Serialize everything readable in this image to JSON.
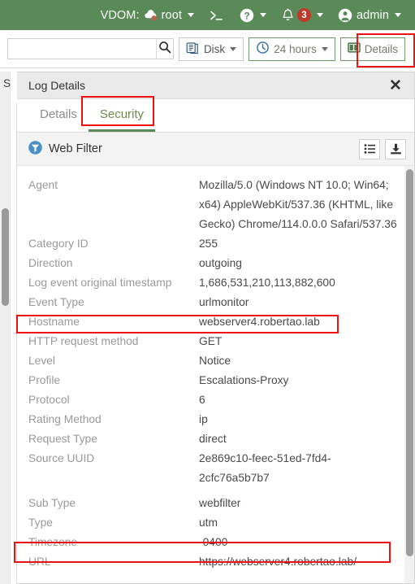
{
  "topbar": {
    "vdom_label": "VDOM:",
    "vdom_icon": "cloud-gear-icon",
    "vdom_value": "root",
    "cli_icon": "cli-console-icon",
    "help_icon": "help-question-icon",
    "alert_icon": "bell-icon",
    "alert_count": "3",
    "user_icon": "user-avatar-icon",
    "user_name": "admin"
  },
  "toolbar": {
    "search_value": "",
    "search_placeholder": "",
    "search_icon": "search-icon",
    "disk_label": "Disk",
    "disk_icon": "disk-stack-icon",
    "time_label": "24 hours",
    "time_icon": "clock-icon",
    "details_label": "Details",
    "details_icon": "panel-split-icon"
  },
  "background": {
    "left_fragment": "S"
  },
  "dialog": {
    "title": "Log Details",
    "close_icon": "close-icon",
    "tabs": [
      {
        "label": "Details",
        "active": false
      },
      {
        "label": "Security",
        "active": true
      }
    ],
    "section": {
      "icon": "web-filter-funnel-icon",
      "title": "Web Filter",
      "list_view_icon": "list-view-icon",
      "download_icon": "download-icon"
    },
    "rows": [
      {
        "key": "Agent",
        "value": "Mozilla/5.0 (Windows NT 10.0; Win64; x64) AppleWebKit/537.36 (KHTML, like Gecko) Chrome/114.0.0.0 Safari/537.36"
      },
      {
        "key": "Category ID",
        "value": "255"
      },
      {
        "key": "Direction",
        "value": "outgoing"
      },
      {
        "key": "Log event original timestamp",
        "value": "1,686,531,210,113,882,600"
      },
      {
        "key": "Event Type",
        "value": "urlmonitor"
      },
      {
        "key": "Hostname",
        "value": "webserver4.robertao.lab"
      },
      {
        "key": "HTTP request method",
        "value": "GET"
      },
      {
        "key": "Level",
        "value": "Notice"
      },
      {
        "key": "Profile",
        "value": "Escalations-Proxy"
      },
      {
        "key": "Protocol",
        "value": "6"
      },
      {
        "key": "Rating Method",
        "value": "ip"
      },
      {
        "key": "Request Type",
        "value": "direct"
      },
      {
        "key": "Source UUID",
        "value": "2e869c10-feec-51ed-7fd4-2cfc76a5b7b7"
      },
      {
        "key": "Sub Type",
        "value": "webfilter"
      },
      {
        "key": "Type",
        "value": "utm"
      },
      {
        "key": "Timezone",
        "value": "-0400"
      },
      {
        "key": "URL",
        "value": "https://webserver4.robertao.lab/"
      }
    ]
  },
  "colors": {
    "brand_green": "#5a8a58",
    "alert_red": "#c0392b",
    "highlight_red": "#ee1111",
    "section_blue": "#4a92c4"
  }
}
